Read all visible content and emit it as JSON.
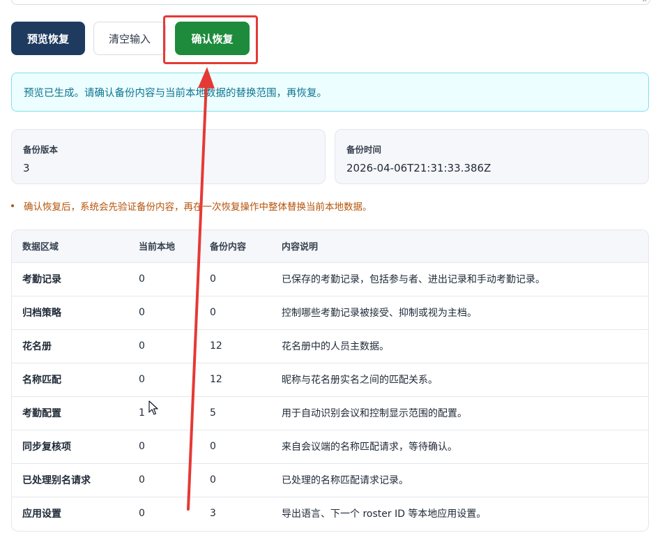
{
  "toolbar": {
    "preview_label": "预览恢复",
    "clear_label": "清空输入",
    "confirm_label": "确认恢复"
  },
  "alert": {
    "message": "预览已生成。请确认备份内容与当前本地数据的替换范围，再恢复。"
  },
  "summary": {
    "version_label": "备份版本",
    "version_value": "3",
    "time_label": "备份时间",
    "time_value": "2026-04-06T21:31:33.386Z"
  },
  "note": "确认恢复后，系统会先验证备份内容，再在一次恢复操作中整体替换当前本地数据。",
  "table": {
    "headers": [
      "数据区域",
      "当前本地",
      "备份内容",
      "内容说明"
    ],
    "rows": [
      {
        "area": "考勤记录",
        "local": "0",
        "backup": "0",
        "desc": "已保存的考勤记录，包括参与者、进出记录和手动考勤记录。"
      },
      {
        "area": "归档策略",
        "local": "0",
        "backup": "0",
        "desc": "控制哪些考勤记录被接受、抑制或视为主档。"
      },
      {
        "area": "花名册",
        "local": "0",
        "backup": "12",
        "desc": "花名册中的人员主数据。"
      },
      {
        "area": "名称匹配",
        "local": "0",
        "backup": "12",
        "desc": "昵称与花名册实名之间的匹配关系。"
      },
      {
        "area": "考勤配置",
        "local": "1",
        "backup": "5",
        "desc": "用于自动识别会议和控制显示范围的配置。"
      },
      {
        "area": "同步复核项",
        "local": "0",
        "backup": "0",
        "desc": "来自会议端的名称匹配请求，等待确认。"
      },
      {
        "area": "已处理别名请求",
        "local": "0",
        "backup": "0",
        "desc": "已处理的名称匹配请求记录。"
      },
      {
        "area": "应用设置",
        "local": "0",
        "backup": "3",
        "desc": "导出语言、下一个 roster ID 等本地应用设置。"
      }
    ]
  },
  "colors": {
    "primary": "#1e3a5f",
    "confirm": "#1e8a3c",
    "alert_bg": "#ecfeff",
    "alert_text": "#0e7490",
    "note_text": "#b45309",
    "annotation": "#e53935"
  },
  "icons": [
    "resize-grip-icon",
    "mouse-cursor-icon",
    "annotation-arrow"
  ]
}
